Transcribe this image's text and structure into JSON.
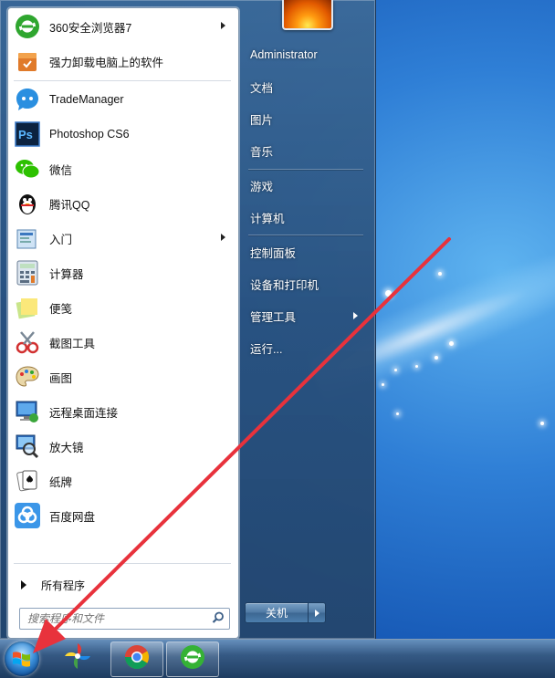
{
  "start_menu": {
    "programs": [
      {
        "label": "360安全浏览器7",
        "icon": "browser-360-icon",
        "has_submenu": true
      },
      {
        "label": "强力卸载电脑上的软件",
        "icon": "uninstall-box-icon",
        "has_submenu": false
      },
      {
        "label": "TradeManager",
        "icon": "trademanager-icon",
        "has_submenu": false
      },
      {
        "label": "Photoshop CS6",
        "icon": "photoshop-icon",
        "has_submenu": false
      },
      {
        "label": "微信",
        "icon": "wechat-icon",
        "has_submenu": false
      },
      {
        "label": "腾讯QQ",
        "icon": "qq-penguin-icon",
        "has_submenu": false
      },
      {
        "label": "入门",
        "icon": "getting-started-icon",
        "has_submenu": true
      },
      {
        "label": "计算器",
        "icon": "calculator-icon",
        "has_submenu": false
      },
      {
        "label": "便笺",
        "icon": "sticky-notes-icon",
        "has_submenu": false
      },
      {
        "label": "截图工具",
        "icon": "snipping-tool-icon",
        "has_submenu": false
      },
      {
        "label": "画图",
        "icon": "paint-palette-icon",
        "has_submenu": false
      },
      {
        "label": "远程桌面连接",
        "icon": "remote-desktop-icon",
        "has_submenu": false
      },
      {
        "label": "放大镜",
        "icon": "magnifier-icon",
        "has_submenu": false
      },
      {
        "label": "纸牌",
        "icon": "solitaire-cards-icon",
        "has_submenu": false
      },
      {
        "label": "百度网盘",
        "icon": "baidu-netdisk-icon",
        "has_submenu": false
      }
    ],
    "all_programs_label": "所有程序",
    "search_placeholder": "搜索程序和文件",
    "right_items": [
      {
        "label": "Administrator",
        "has_submenu": false
      },
      {
        "label": "文档",
        "has_submenu": false
      },
      {
        "label": "图片",
        "has_submenu": false
      },
      {
        "label": "音乐",
        "has_submenu": false
      },
      {
        "label": "游戏",
        "has_submenu": false
      },
      {
        "label": "计算机",
        "has_submenu": false
      },
      {
        "label": "控制面板",
        "has_submenu": false
      },
      {
        "label": "设备和打印机",
        "has_submenu": false
      },
      {
        "label": "管理工具",
        "has_submenu": true
      },
      {
        "label": "运行...",
        "has_submenu": false
      }
    ],
    "shutdown_label": "关机"
  },
  "taskbar": {
    "items": [
      {
        "icon": "windows-start-orb-icon"
      },
      {
        "icon": "pinwheel-app-icon"
      },
      {
        "icon": "chrome-icon",
        "active": true
      },
      {
        "icon": "browser-360-icon",
        "active": true
      }
    ]
  },
  "colors": {
    "desktop": "#1e6cc8",
    "annotation_arrow": "#e8323c"
  }
}
